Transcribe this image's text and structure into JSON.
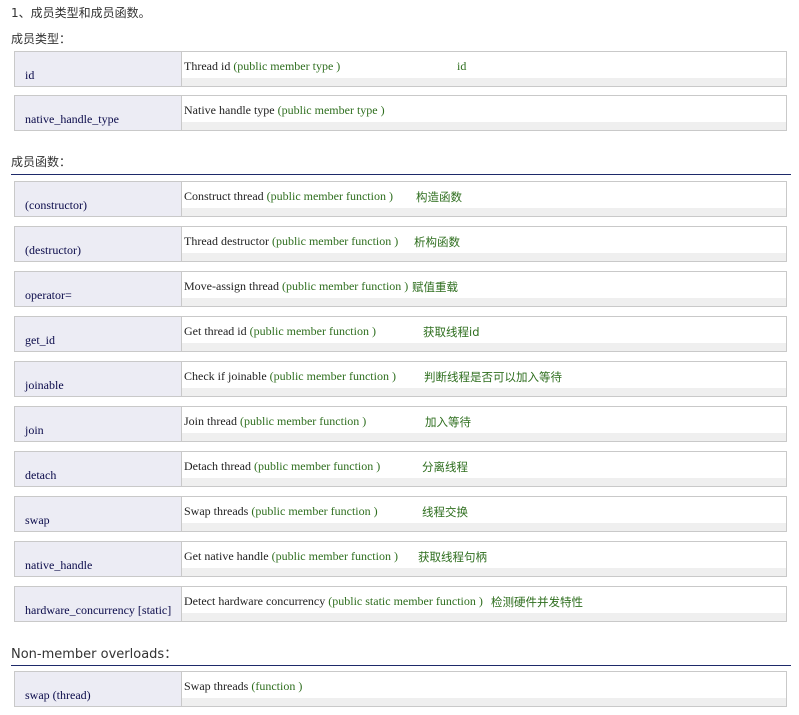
{
  "heading": "1、成员类型和成员函数。",
  "types_label": "成员类型：",
  "functions_label": "成员函数：",
  "nonmember_label": "Non-member overloads：",
  "member_types": [
    {
      "name": "id",
      "desc": "Thread id",
      "kind": "(public member type )",
      "note": "id"
    },
    {
      "name": "native_handle_type",
      "desc": "Native handle type",
      "kind": "(public member type )",
      "note": ""
    }
  ],
  "member_functions": [
    {
      "name": "(constructor)",
      "desc": "Construct thread",
      "kind": "(public member function )",
      "note": "构造函数"
    },
    {
      "name": "(destructor)",
      "desc": "Thread destructor",
      "kind": "(public member function )",
      "note": "析构函数"
    },
    {
      "name": "operator=",
      "desc": "Move-assign thread",
      "kind": "(public member function )",
      "note": "赋值重载"
    },
    {
      "name": "get_id",
      "desc": "Get thread id",
      "kind": "(public member function )",
      "note": "获取线程id"
    },
    {
      "name": "joinable",
      "desc": "Check if joinable",
      "kind": "(public member function )",
      "note": "判断线程是否可以加入等待"
    },
    {
      "name": "join",
      "desc": "Join thread",
      "kind": "(public member function )",
      "note": "加入等待"
    },
    {
      "name": "detach",
      "desc": "Detach thread",
      "kind": "(public member function )",
      "note": "分离线程"
    },
    {
      "name": "swap",
      "desc": "Swap threads",
      "kind": "(public member function )",
      "note": "线程交换"
    },
    {
      "name": "native_handle",
      "desc": "Get native handle",
      "kind": "(public member function )",
      "note": "获取线程句柄"
    },
    {
      "name": "hardware_concurrency [static]",
      "desc": "Detect hardware concurrency",
      "kind": "(public static member function )",
      "note": "检测硬件并发特性"
    }
  ],
  "nonmember": [
    {
      "name": "swap (thread)",
      "desc": "Swap threads",
      "kind": "(function )",
      "note": ""
    }
  ]
}
